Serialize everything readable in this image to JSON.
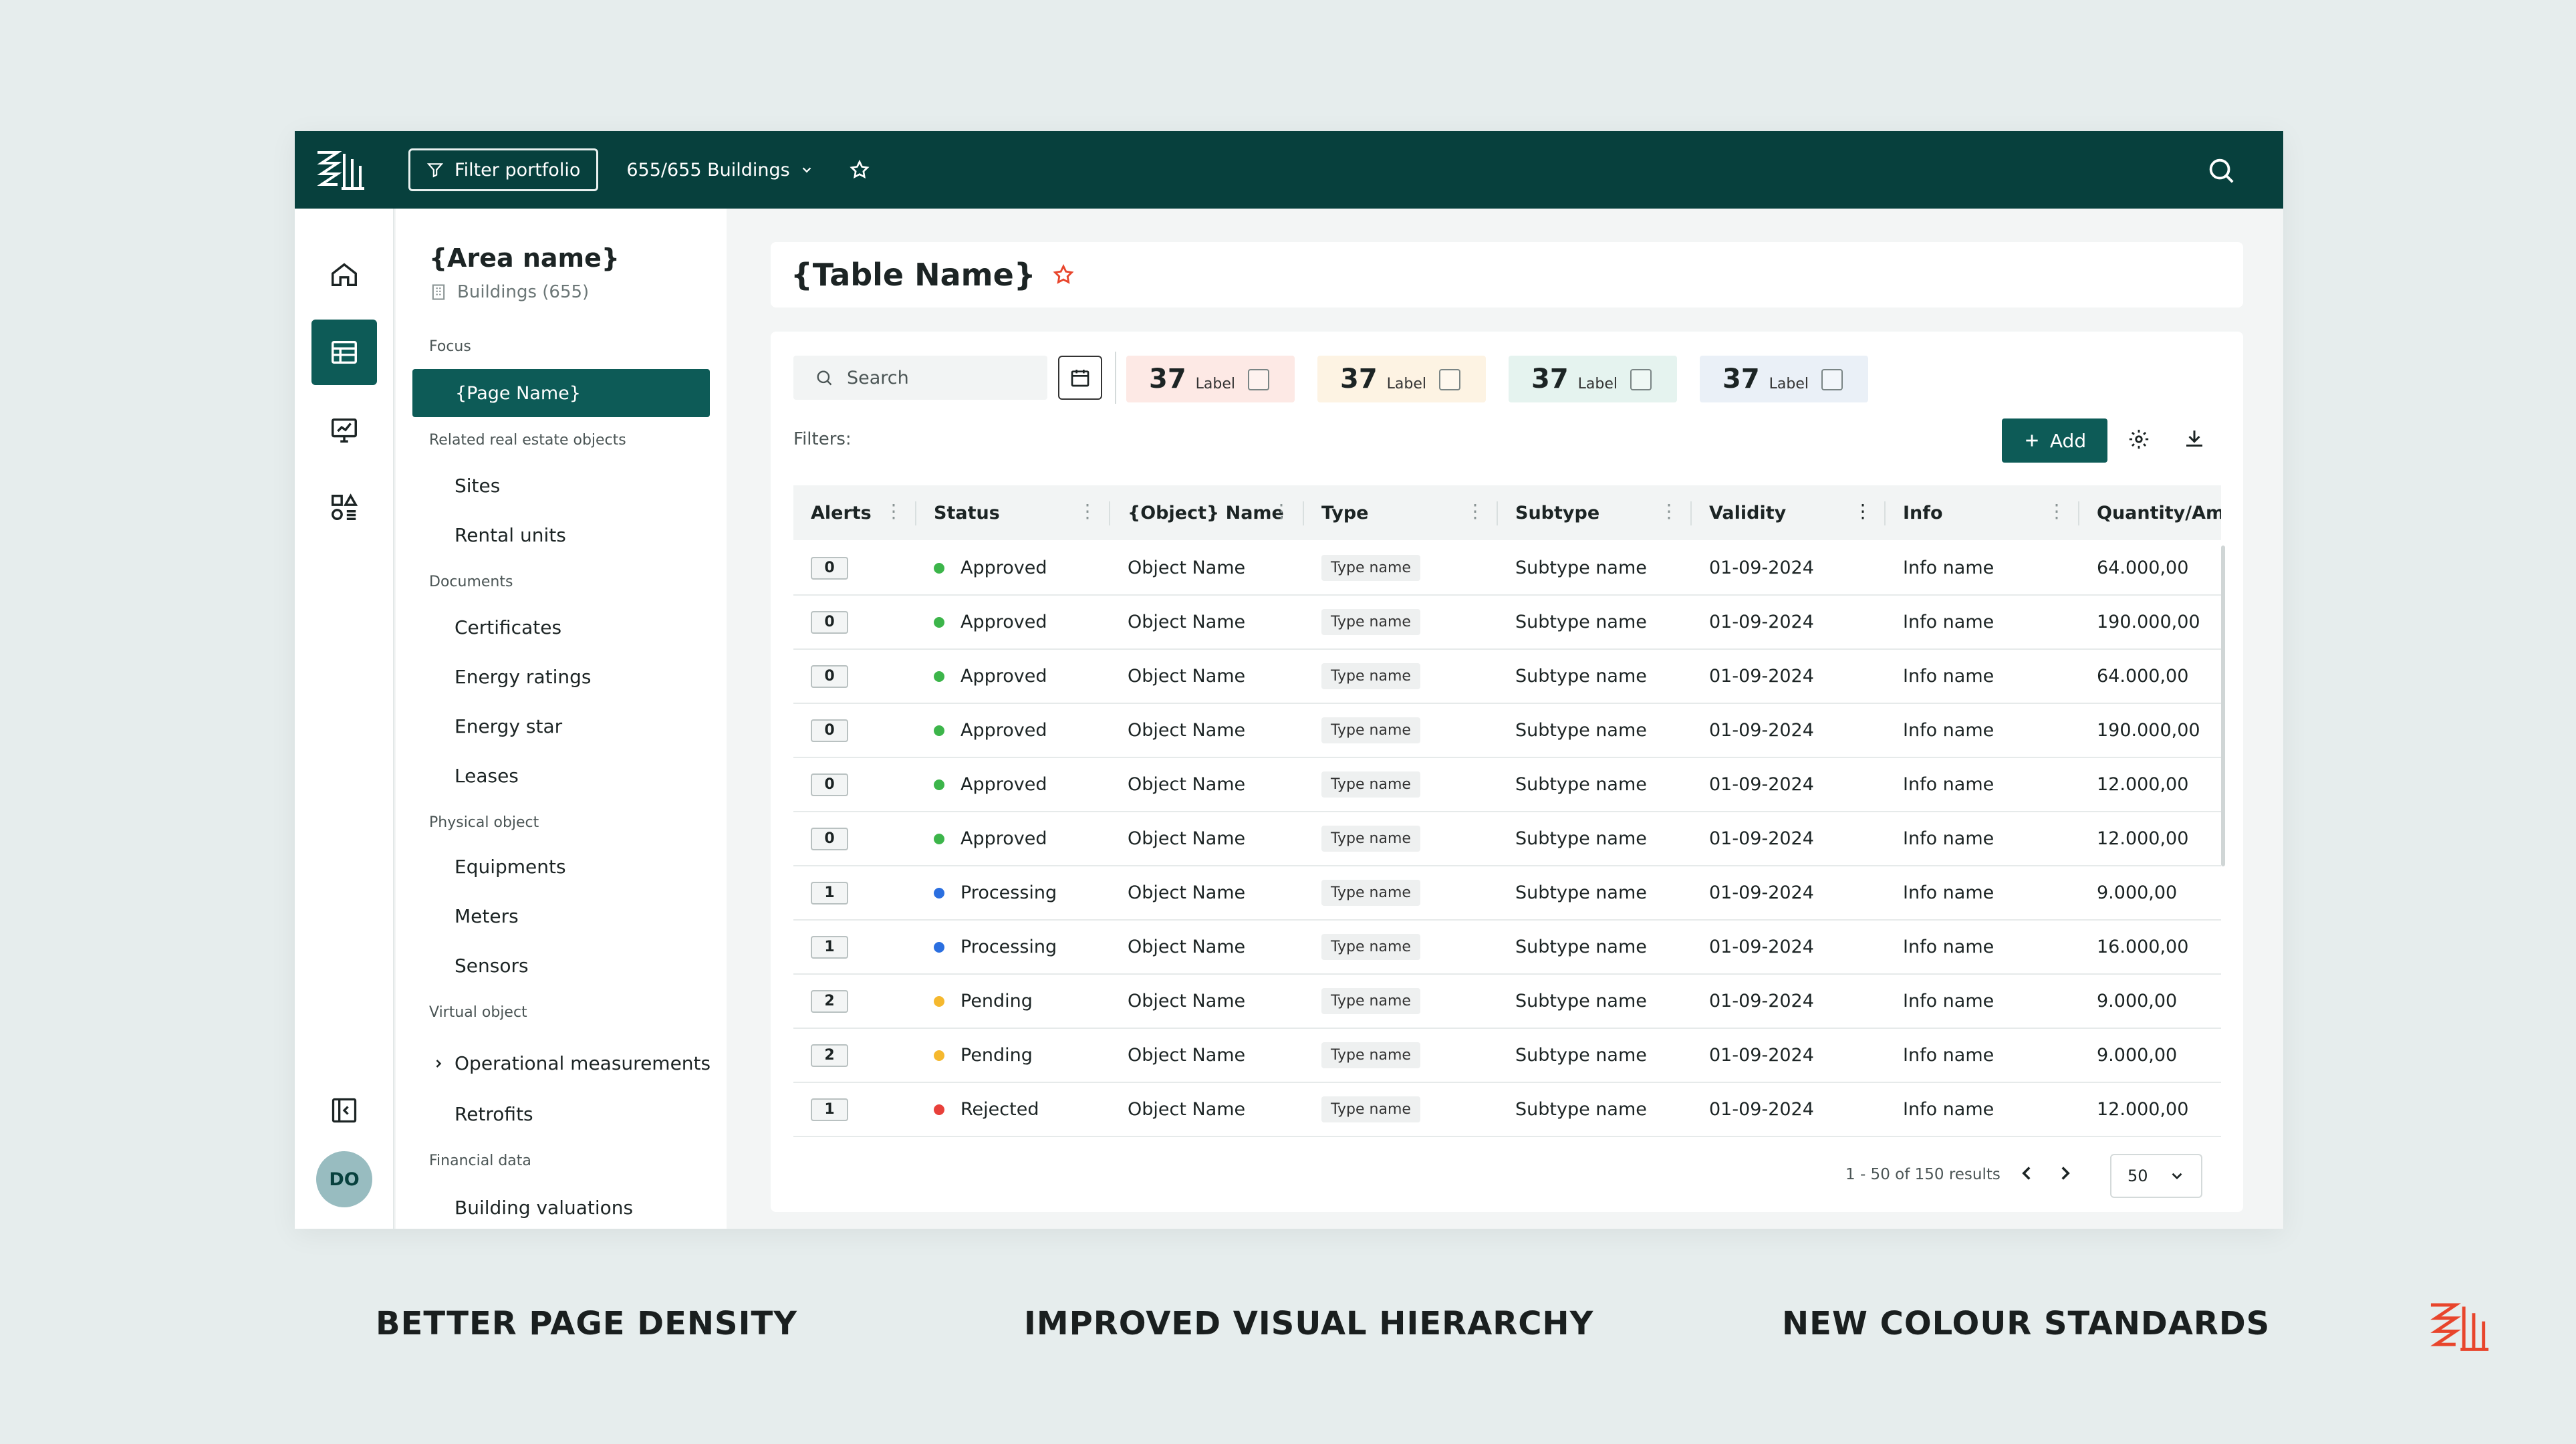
{
  "topbar": {
    "filter_label": "Filter portfolio",
    "buildings_label": "655/655 Buildings"
  },
  "rail": {
    "avatar_initials": "DO"
  },
  "subnav": {
    "area_name": "{Area name}",
    "area_sub": "Buildings (655)",
    "sections": [
      {
        "title": "Focus"
      },
      {
        "title": "Related real estate objects"
      },
      {
        "title": "Documents"
      },
      {
        "title": "Physical object"
      },
      {
        "title": "Virtual object"
      },
      {
        "title": "Financial data"
      }
    ],
    "active_item": "{Page Name}",
    "items": [
      "Sites",
      "Rental units",
      "Certificates",
      "Energy ratings",
      "Energy star",
      "Leases",
      "Equipments",
      "Meters",
      "Sensors",
      "Operational measurements",
      "Retrofits",
      "Building valuations"
    ]
  },
  "main": {
    "title": "{Table Name}",
    "search_placeholder": "Search",
    "filters_label": "Filters:",
    "add_label": "Add",
    "chips": [
      {
        "count": "37",
        "label": "Label",
        "color": "#fde9e5"
      },
      {
        "count": "37",
        "label": "Label",
        "color": "#fdf3e3"
      },
      {
        "count": "37",
        "label": "Label",
        "color": "#e5f3ef"
      },
      {
        "count": "37",
        "label": "Label",
        "color": "#eaf0f7"
      }
    ],
    "columns": [
      "Alerts",
      "Status",
      "{Object} Name",
      "Type",
      "Subtype",
      "Validity",
      "Info",
      "Quantity/Amo"
    ],
    "rows": [
      {
        "alerts": "0",
        "status": "Approved",
        "status_color": "#3cb54a",
        "name": "Object Name",
        "type": "Type name",
        "subtype": "Subtype name",
        "validity": "01-09-2024",
        "info": "Info name",
        "qty": "64.000,00"
      },
      {
        "alerts": "0",
        "status": "Approved",
        "status_color": "#3cb54a",
        "name": "Object Name",
        "type": "Type name",
        "subtype": "Subtype name",
        "validity": "01-09-2024",
        "info": "Info name",
        "qty": "190.000,00"
      },
      {
        "alerts": "0",
        "status": "Approved",
        "status_color": "#3cb54a",
        "name": "Object Name",
        "type": "Type name",
        "subtype": "Subtype name",
        "validity": "01-09-2024",
        "info": "Info name",
        "qty": "64.000,00"
      },
      {
        "alerts": "0",
        "status": "Approved",
        "status_color": "#3cb54a",
        "name": "Object Name",
        "type": "Type name",
        "subtype": "Subtype name",
        "validity": "01-09-2024",
        "info": "Info name",
        "qty": "190.000,00"
      },
      {
        "alerts": "0",
        "status": "Approved",
        "status_color": "#3cb54a",
        "name": "Object Name",
        "type": "Type name",
        "subtype": "Subtype name",
        "validity": "01-09-2024",
        "info": "Info name",
        "qty": "12.000,00"
      },
      {
        "alerts": "0",
        "status": "Approved",
        "status_color": "#3cb54a",
        "name": "Object Name",
        "type": "Type name",
        "subtype": "Subtype name",
        "validity": "01-09-2024",
        "info": "Info name",
        "qty": "12.000,00"
      },
      {
        "alerts": "1",
        "status": "Processing",
        "status_color": "#2b6fe0",
        "name": "Object Name",
        "type": "Type name",
        "subtype": "Subtype name",
        "validity": "01-09-2024",
        "info": "Info name",
        "qty": "9.000,00"
      },
      {
        "alerts": "1",
        "status": "Processing",
        "status_color": "#2b6fe0",
        "name": "Object Name",
        "type": "Type name",
        "subtype": "Subtype name",
        "validity": "01-09-2024",
        "info": "Info name",
        "qty": "16.000,00"
      },
      {
        "alerts": "2",
        "status": "Pending",
        "status_color": "#f5b82e",
        "name": "Object Name",
        "type": "Type name",
        "subtype": "Subtype name",
        "validity": "01-09-2024",
        "info": "Info name",
        "qty": "9.000,00"
      },
      {
        "alerts": "2",
        "status": "Pending",
        "status_color": "#f5b82e",
        "name": "Object Name",
        "type": "Type name",
        "subtype": "Subtype name",
        "validity": "01-09-2024",
        "info": "Info name",
        "qty": "9.000,00"
      },
      {
        "alerts": "1",
        "status": "Rejected",
        "status_color": "#e8403a",
        "name": "Object Name",
        "type": "Type name",
        "subtype": "Subtype name",
        "validity": "01-09-2024",
        "info": "Info name",
        "qty": "12.000,00"
      }
    ],
    "pagination": {
      "results": "1 - 50 of 150 results",
      "page_size": "50"
    }
  },
  "captions": [
    "BETTER PAGE DENSITY",
    "IMPROVED VISUAL HIERARCHY",
    "NEW COLOUR STANDARDS"
  ],
  "colors": {
    "brand_dark": "#07403d",
    "accent": "#0d5b57",
    "brand_orange": "#e8452c",
    "favorite_star": "#e8452c"
  }
}
